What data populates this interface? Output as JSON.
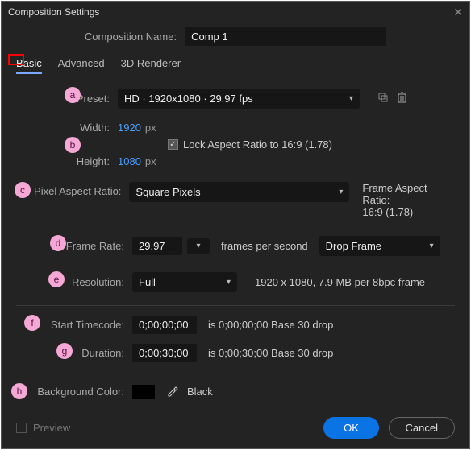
{
  "title": "Composition Settings",
  "compNameLabel": "Composition Name:",
  "compName": "Comp 1",
  "tabs": {
    "basic": "Basic",
    "advanced": "Advanced",
    "renderer": "3D Renderer"
  },
  "preset": {
    "label": "Preset:",
    "value": "HD · 1920x1080 · 29.97 fps"
  },
  "width": {
    "label": "Width:",
    "value": "1920",
    "unit": "px"
  },
  "height": {
    "label": "Height:",
    "value": "1080",
    "unit": "px"
  },
  "lockAR": {
    "label": "Lock Aspect Ratio to 16:9 (1.78)"
  },
  "par": {
    "label": "Pixel Aspect Ratio:",
    "value": "Square Pixels"
  },
  "farLabel": "Frame Aspect Ratio:",
  "farValue": "16:9 (1.78)",
  "frameRate": {
    "label": "Frame Rate:",
    "value": "29.97",
    "fpsLabel": "frames per second"
  },
  "dropFrame": "Drop Frame",
  "resolution": {
    "label": "Resolution:",
    "value": "Full",
    "info": "1920 x 1080, 7.9 MB per 8bpc frame"
  },
  "startTC": {
    "label": "Start Timecode:",
    "value": "0;00;00;00",
    "info": "is 0;00;00;00  Base 30   drop"
  },
  "duration": {
    "label": "Duration:",
    "value": "0;00;30;00",
    "info": "is 0;00;30;00  Base 30   drop"
  },
  "bgColor": {
    "label": "Background Color:",
    "name": "Black"
  },
  "preview": "Preview",
  "ok": "OK",
  "cancel": "Cancel",
  "bubbles": {
    "a": "a",
    "b": "b",
    "c": "c",
    "d": "d",
    "e": "e",
    "f": "f",
    "g": "g",
    "h": "h"
  }
}
